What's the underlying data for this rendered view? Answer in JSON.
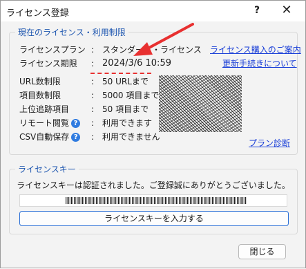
{
  "window": {
    "title": "ライセンス登録",
    "help_label": "?",
    "close_label": "✕"
  },
  "license_group": {
    "legend": "現在のライセンス・利用制限",
    "rows": [
      {
        "label": "ライセンスプラン",
        "colon": ":",
        "value": "スタンダード・ライセンス"
      },
      {
        "label": "ライセンス期限",
        "colon": ":",
        "value": "2024/3/6 10:59"
      },
      {
        "label": "URL数制限",
        "colon": ":",
        "value": "50 URLまで"
      },
      {
        "label": "項目数制限",
        "colon": ":",
        "value": "5000 項目まで"
      },
      {
        "label": "上位追跡項目",
        "colon": ":",
        "value": "50 項目まで"
      },
      {
        "label": "リモート閲覧",
        "colon": ":",
        "value": "利用できます"
      },
      {
        "label": "CSV自動保存",
        "colon": ":",
        "value": "利用できません"
      }
    ],
    "links": {
      "purchase": "ライセンス購入のご案内",
      "renew": "更新手続きについて",
      "diagnosis": "プラン診断"
    }
  },
  "key_group": {
    "legend": "ライセンスキー",
    "notice": "ライセンスキーは認証されました。ご登録誠にありがとうございました。",
    "enter_button": "ライセンスキーを入力する"
  },
  "footer": {
    "close_button": "閉じる"
  },
  "colors": {
    "accent": "#1f57b0",
    "link": "#1a3fd8",
    "annotation": "#e83030"
  },
  "icons": {
    "help": "question-circle-icon"
  }
}
